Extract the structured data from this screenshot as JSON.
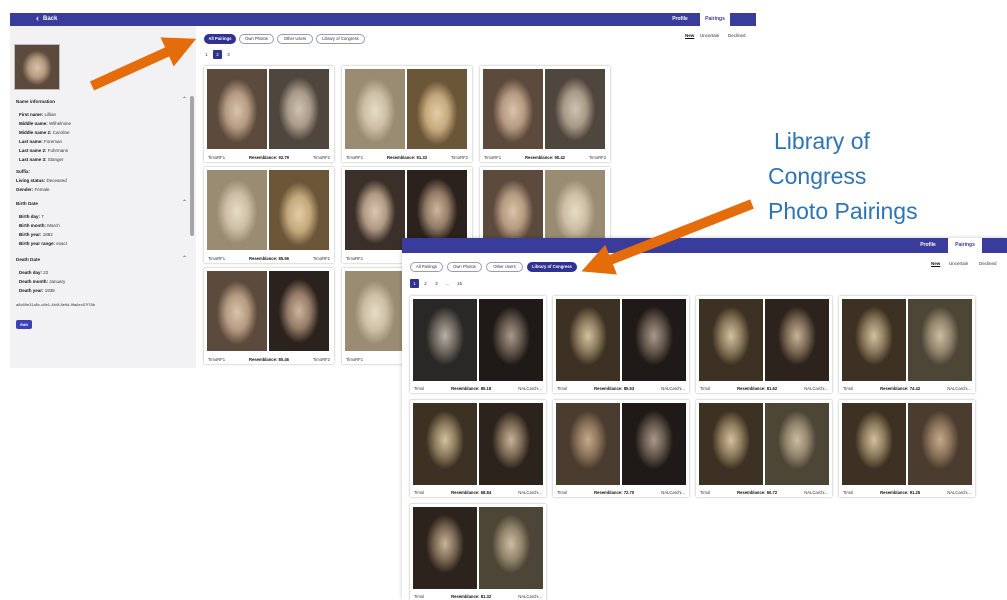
{
  "back_panel": {
    "nav": {
      "back_label": "Back",
      "tabs": [
        {
          "label": "Profile",
          "active": false
        },
        {
          "label": "Pairings",
          "active": true
        }
      ]
    },
    "sidebar": {
      "name_section": "Name information",
      "name_fields": [
        {
          "label": "First name:",
          "value": "Lillian"
        },
        {
          "label": "Middle name:",
          "value": "Wilhelmine"
        },
        {
          "label": "Middle name 2:",
          "value": "Caroline"
        },
        {
          "label": "Last name:",
          "value": "Foreman"
        },
        {
          "label": "Last name 2:",
          "value": "Fuhrmann"
        },
        {
          "label": "Last name 3:",
          "value": "Stanger"
        }
      ],
      "other_fields": [
        {
          "label": "Suffix:",
          "value": ""
        },
        {
          "label": "Living status:",
          "value": "Deceased"
        },
        {
          "label": "Gender:",
          "value": "Female"
        }
      ],
      "birth_section": "Birth Date",
      "birth_fields": [
        {
          "label": "Birth day:",
          "value": "7"
        },
        {
          "label": "Birth month:",
          "value": "March"
        },
        {
          "label": "Birth year:",
          "value": "1882"
        },
        {
          "label": "Birth year range:",
          "value": "exact"
        }
      ],
      "death_section": "Death Date",
      "death_fields": [
        {
          "label": "Death day:",
          "value": "22"
        },
        {
          "label": "Death month:",
          "value": "January"
        },
        {
          "label": "Death year:",
          "value": "1938"
        }
      ],
      "record_id": "a8c69e31a5c-c8e1-4b4f-8e9d-9fa6ec57f78b",
      "edit_label": "Edit"
    },
    "source_tabs": [
      {
        "label": "All Pairings",
        "active": true
      },
      {
        "label": "Own Photos",
        "active": false
      },
      {
        "label": "Other Users",
        "active": false
      },
      {
        "label": "Library of Congress",
        "active": false
      }
    ],
    "status_filters": [
      {
        "label": "New",
        "active": true
      },
      {
        "label": "Uncertain",
        "active": false
      },
      {
        "label": "Declined",
        "active": false
      }
    ],
    "pagination": [
      {
        "label": "1",
        "active": false
      },
      {
        "label": "2",
        "active": true
      },
      {
        "label": "3",
        "active": false
      }
    ],
    "cards": [
      {
        "left": "TimoRF1",
        "resemblance": "Resemblance: 92.79",
        "right": "TimoRF2"
      },
      {
        "left": "TimoRF1",
        "resemblance": "Resemblance: 91.33",
        "right": "TimoRF2"
      },
      {
        "left": "TimoRF1",
        "resemblance": "Resemblance: 90.42",
        "right": "TimoRF2"
      },
      {
        "left": "TimoRF1",
        "resemblance": "Resemblance: 85.56",
        "right": "TimoRF2"
      },
      {
        "left": "TimoRF1",
        "resemblance": "Resemblance",
        "right": ""
      },
      {
        "left": "",
        "resemblance": "",
        "right": ""
      },
      {
        "left": "TimoRF1",
        "resemblance": "Resemblance: 80.46",
        "right": "TimoRF2"
      },
      {
        "left": "TimoRF1",
        "resemblance": "Resemb",
        "right": ""
      }
    ]
  },
  "front_panel": {
    "nav": {
      "tabs": [
        {
          "label": "Profile",
          "active": false
        },
        {
          "label": "Pairings",
          "active": true
        }
      ]
    },
    "source_tabs": [
      {
        "label": "All Pairings",
        "active": false
      },
      {
        "label": "Own Photos",
        "active": false
      },
      {
        "label": "Other Users",
        "active": false
      },
      {
        "label": "Library of Congress",
        "active": true
      }
    ],
    "status_filters": [
      {
        "label": "New",
        "active": true
      },
      {
        "label": "Uncertain",
        "active": false
      },
      {
        "label": "Declined",
        "active": false
      }
    ],
    "pagination": [
      {
        "label": "1",
        "active": true
      },
      {
        "label": "2",
        "active": false
      },
      {
        "label": "3",
        "active": false
      },
      {
        "label": "...",
        "active": false
      },
      {
        "label": "15",
        "active": false
      }
    ],
    "cards": [
      {
        "left": "Timol",
        "resemblance": "Resemblance: 85.18",
        "right": "NALCarchi..."
      },
      {
        "left": "Timol",
        "resemblance": "Resemblance: 85.53",
        "right": "NALCarchi..."
      },
      {
        "left": "Timol",
        "resemblance": "Resemblance: 81.62",
        "right": "NALCarchi..."
      },
      {
        "left": "Timol",
        "resemblance": "Resemblance: 74.42",
        "right": "NALCarchi..."
      },
      {
        "left": "Timol",
        "resemblance": "Resemblance: 68.84",
        "right": "NALCarchi..."
      },
      {
        "left": "Timol",
        "resemblance": "Resemblance: 72.70",
        "right": "NALCarchi..."
      },
      {
        "left": "Timol",
        "resemblance": "Resemblance: 60.72",
        "right": "NALCarchi..."
      },
      {
        "left": "Timol",
        "resemblance": "Resemblance: 91.25",
        "right": "NALCarchi..."
      },
      {
        "left": "Timol",
        "resemblance": "Resemblance: 81.32",
        "right": "NALCarchi..."
      }
    ]
  },
  "annotation": {
    "lines": [
      "Library of",
      "Congress",
      "Photo Pairings"
    ],
    "text_color": "#2e74b5",
    "arrow_color": "#e46c0a"
  },
  "colors": {
    "brand": "#3a3c9b",
    "active_pill": "#2f3290"
  }
}
